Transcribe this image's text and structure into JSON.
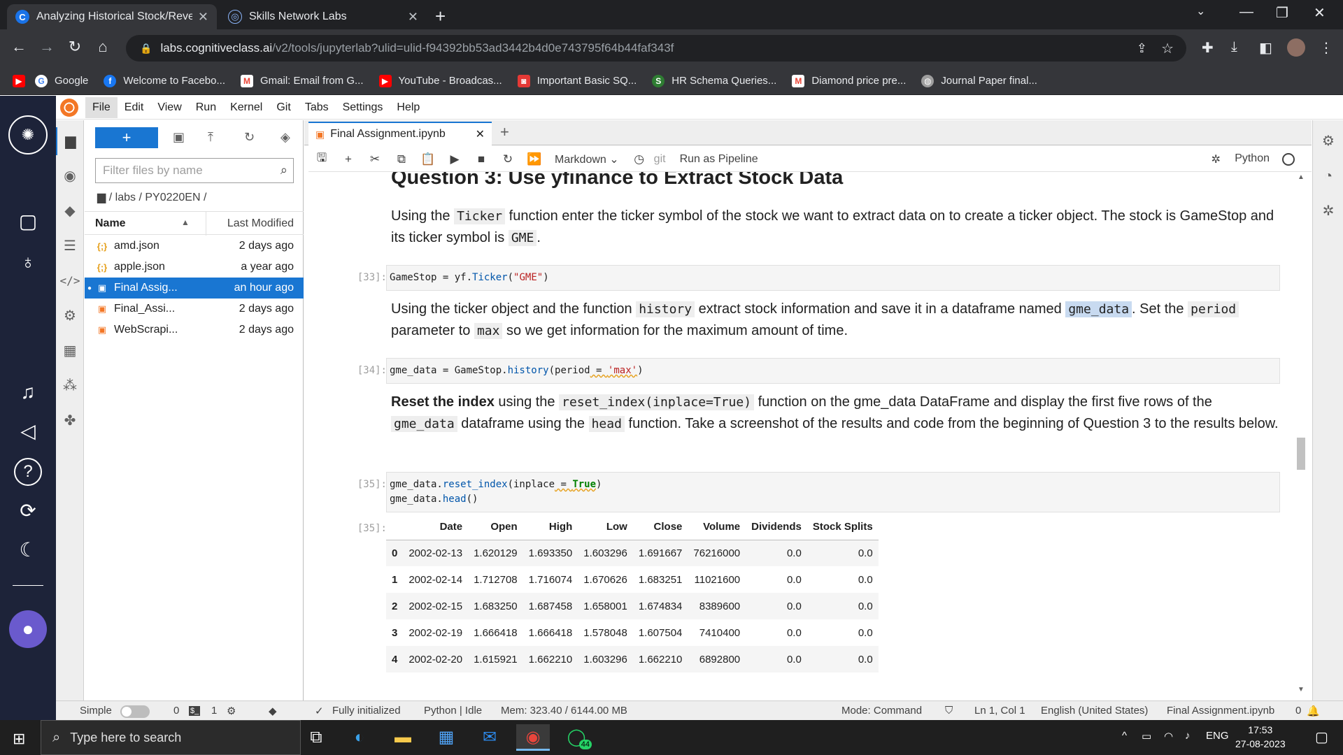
{
  "browser": {
    "tabs": [
      {
        "title": "Analyzing Historical Stock/Reven",
        "active": true
      },
      {
        "title": "Skills Network Labs",
        "active": false
      }
    ],
    "url_host": "labs.cognitiveclass.ai",
    "url_path": "/v2/tools/jupyterlab?ulid=ulid-f94392bb53ad3442b4d0e743795f64b44faf343f",
    "bookmarks": [
      {
        "label": "",
        "icon": "youtube-icon",
        "color": "#ff0000"
      },
      {
        "label": "Google",
        "icon": "google-icon",
        "color": "#4285f4"
      },
      {
        "label": "Welcome to Facebo...",
        "icon": "facebook-icon",
        "color": "#1877f2"
      },
      {
        "label": "Gmail: Email from G...",
        "icon": "gmail-icon",
        "color": "#ea4335"
      },
      {
        "label": "YouTube - Broadcas...",
        "icon": "youtube-icon",
        "color": "#ff0000"
      },
      {
        "label": "Important Basic SQ...",
        "icon": "bookmark-icon",
        "color": "#e53935"
      },
      {
        "label": "HR Schema Queries...",
        "icon": "bookmark-icon",
        "color": "#2e7d32"
      },
      {
        "label": "Diamond price pre...",
        "icon": "gmail-icon",
        "color": "#ea4335"
      },
      {
        "label": "Journal Paper final...",
        "icon": "globe-icon",
        "color": "#9e9e9e"
      }
    ]
  },
  "menubar": {
    "items": [
      "File",
      "Edit",
      "View",
      "Run",
      "Kernel",
      "Git",
      "Tabs",
      "Settings",
      "Help"
    ]
  },
  "filebrowser": {
    "filter_placeholder": "Filter files by name",
    "breadcrumb": "/ labs / PY0220EN /",
    "col_name": "Name",
    "col_modified": "Last Modified",
    "files": [
      {
        "name": "amd.json",
        "modified": "2 days ago",
        "type": "json",
        "icon": "{;}"
      },
      {
        "name": "apple.json",
        "modified": "a year ago",
        "type": "json",
        "icon": "{;}"
      },
      {
        "name": "Final Assig...",
        "modified": "an hour ago",
        "type": "notebook",
        "icon": "▣",
        "selected": true
      },
      {
        "name": "Final_Assi...",
        "modified": "2 days ago",
        "type": "notebook",
        "icon": "▣"
      },
      {
        "name": "WebScrapi...",
        "modified": "2 days ago",
        "type": "notebook",
        "icon": "▣"
      }
    ]
  },
  "notebook": {
    "tab_title": "Final Assignment.ipynb",
    "cell_type": "Markdown",
    "git_label": "git",
    "pipeline_label": "Run as Pipeline",
    "kernel": "Python",
    "heading": "Question 3: Use yfinance to Extract Stock Data",
    "md1": {
      "t1": "Using the ",
      "c1": "Ticker",
      "t2": " function enter the ticker symbol of the stock we want to extract data on to create a ticker object. The stock is GameStop and its ticker symbol is ",
      "c2": "GME",
      "t3": "."
    },
    "cell33": {
      "prompt": "[33]:"
    },
    "md2": {
      "t1": "Using the ticker object and the function ",
      "c1": "history",
      "t2": " extract stock information and save it in a dataframe named ",
      "c2": "gme_data",
      "t3": ". Set the ",
      "c3": "period",
      "t4": " parameter to ",
      "c4": "max",
      "t5": " so we get information for the maximum amount of time."
    },
    "cell34": {
      "prompt": "[34]:"
    },
    "md3": {
      "b1": "Reset the index",
      "t1": " using the ",
      "c1": "reset_index(inplace=True)",
      "t2": " function on the gme_data DataFrame and display the first five rows of the ",
      "c2": "gme_data",
      "t3": " dataframe using the ",
      "c3": "head",
      "t4": " function. Take a screenshot of the results and code from the beginning of Question 3 to the results below."
    },
    "cell35": {
      "prompt": "[35]:",
      "out_prompt": "[35]:"
    },
    "table": {
      "columns": [
        "",
        "Date",
        "Open",
        "High",
        "Low",
        "Close",
        "Volume",
        "Dividends",
        "Stock Splits"
      ],
      "rows": [
        [
          "0",
          "2002-02-13",
          "1.620129",
          "1.693350",
          "1.603296",
          "1.691667",
          "76216000",
          "0.0",
          "0.0"
        ],
        [
          "1",
          "2002-02-14",
          "1.712708",
          "1.716074",
          "1.670626",
          "1.683251",
          "11021600",
          "0.0",
          "0.0"
        ],
        [
          "2",
          "2002-02-15",
          "1.683250",
          "1.687458",
          "1.658001",
          "1.674834",
          "8389600",
          "0.0",
          "0.0"
        ],
        [
          "3",
          "2002-02-19",
          "1.666418",
          "1.666418",
          "1.578048",
          "1.607504",
          "7410400",
          "0.0",
          "0.0"
        ],
        [
          "4",
          "2002-02-20",
          "1.615921",
          "1.662210",
          "1.603296",
          "1.662210",
          "6892800",
          "0.0",
          "0.0"
        ]
      ]
    }
  },
  "statusbar": {
    "mode_simple": "Simple",
    "terminals": "0",
    "kernels": "1",
    "initialized": "Fully initialized",
    "kernel_state": "Python | Idle",
    "memory": "Mem: 323.40 / 6144.00 MB",
    "mode": "Mode: Command",
    "position": "Ln 1, Col 1",
    "language": "English (United States)",
    "file": "Final Assignment.ipynb",
    "notifications": "0"
  },
  "taskbar": {
    "search_placeholder": "Type here to search",
    "whatsapp_badge": "44",
    "lang": "ENG",
    "time": "17:53",
    "date": "27-08-2023"
  },
  "colors": {
    "accent": "#1976d2",
    "sidebar_dark": "#1d2339",
    "jupyter_orange": "#f37726"
  }
}
